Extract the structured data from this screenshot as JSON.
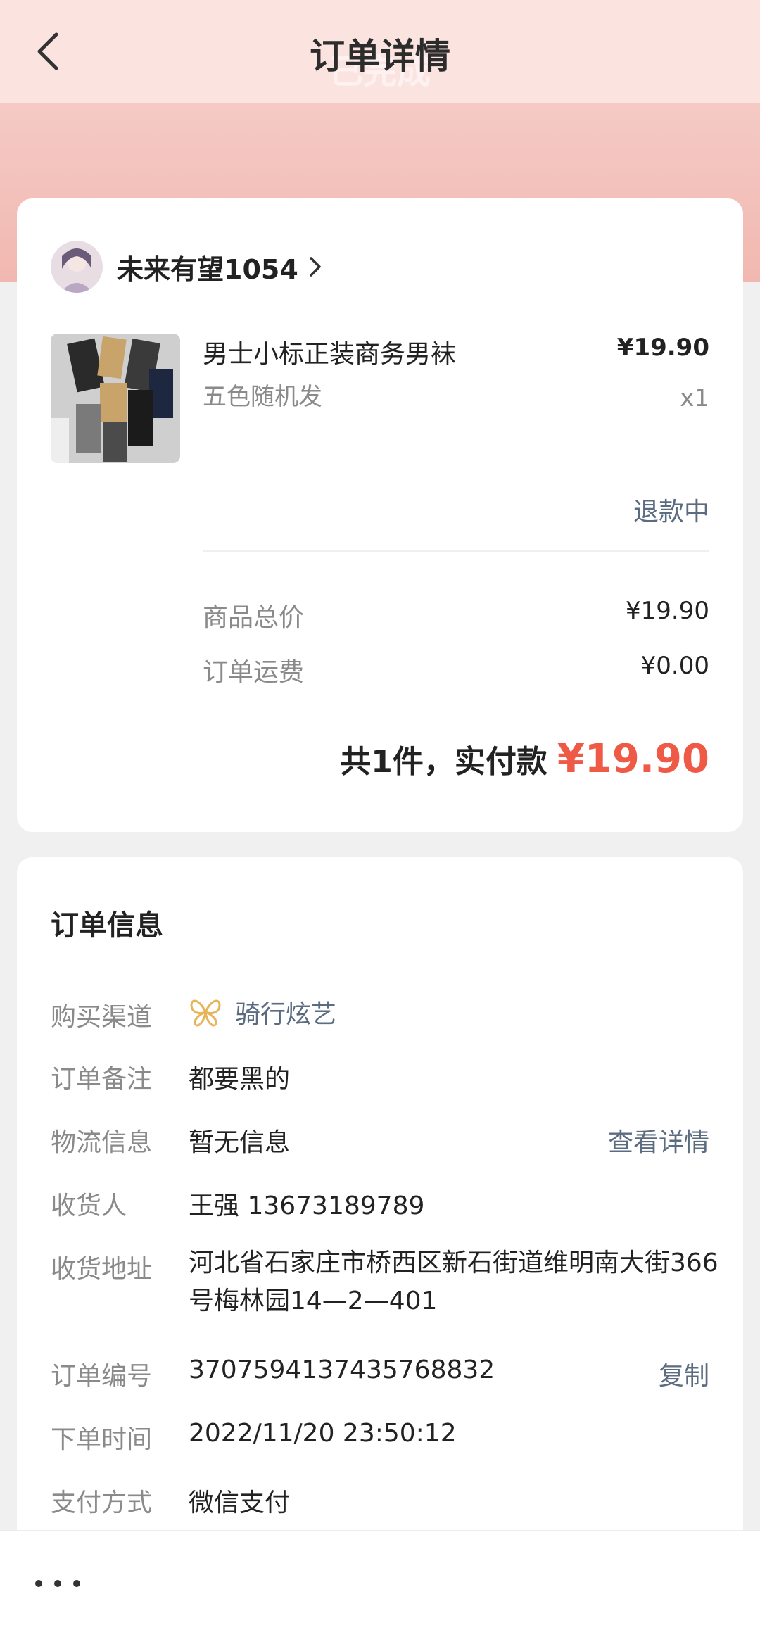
{
  "header": {
    "title": "订单详情",
    "status_ghost": "已完成"
  },
  "shop": {
    "name": "未来有望1054"
  },
  "product": {
    "name": "男士小标正装商务男袜",
    "spec": "五色随机发",
    "price": "¥19.90",
    "qty": "x1",
    "status": "退款中"
  },
  "summary": {
    "goods_total_label": "商品总价",
    "goods_total_value": "¥19.90",
    "shipping_label": "订单运费",
    "shipping_value": "¥0.00",
    "total_text": "共1件，实付款",
    "total_amount": "¥19.90"
  },
  "order_info": {
    "title": "订单信息",
    "channel_label": "购买渠道",
    "channel_value": "骑行炫艺",
    "note_label": "订单备注",
    "note_value": "都要黑的",
    "logistics_label": "物流信息",
    "logistics_value": "暂无信息",
    "logistics_link": "查看详情",
    "receiver_label": "收货人",
    "receiver_value": "王强 13673189789",
    "address_label": "收货地址",
    "address_value": "河北省石家庄市桥西区新石街道维明南大街366号梅林园14—2—401",
    "order_no_label": "订单编号",
    "order_no_value": "3707594137435768832",
    "copy_link": "复制",
    "time_label": "下单时间",
    "time_value": "2022/11/20 23:50:12",
    "pay_label": "支付方式",
    "pay_value": "微信支付"
  },
  "icons": {
    "back": "chevron-left-icon",
    "shop_arrow": "chevron-right-icon",
    "channel_logo": "butterfly-logo-icon",
    "more": "more-dots-icon"
  },
  "colors": {
    "accent": "#ee5a45",
    "link": "#5b6b80",
    "header_bg": "#fbe3e0"
  }
}
